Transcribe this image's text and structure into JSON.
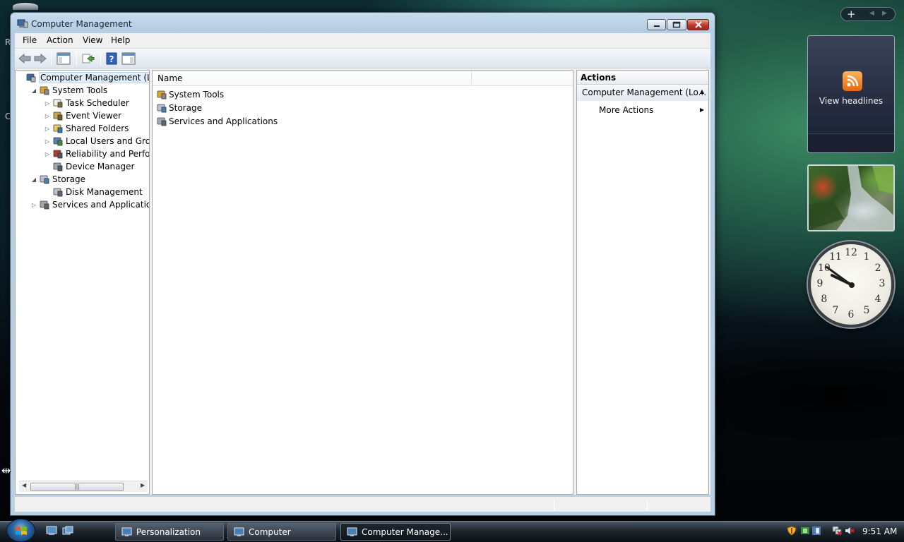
{
  "window": {
    "title": "Computer Management",
    "menu": [
      "File",
      "Action",
      "View",
      "Help"
    ],
    "controls": {
      "minimize": "minimize",
      "maximize": "maximize",
      "close": "close"
    }
  },
  "toolbar": {
    "buttons": [
      "back-icon",
      "forward-icon",
      "show-hide-console-tree-icon",
      "export-list-icon",
      "help-icon",
      "show-hide-action-pane-icon"
    ]
  },
  "tree": {
    "items": [
      {
        "label": "Computer Management (Local",
        "icon": "computer-management-icon",
        "level": 0,
        "expander": "",
        "selected": true
      },
      {
        "label": "System Tools",
        "icon": "tools-icon",
        "level": 1,
        "expander": "◢"
      },
      {
        "label": "Task Scheduler",
        "icon": "clock-icon",
        "level": 2,
        "expander": "▷"
      },
      {
        "label": "Event Viewer",
        "icon": "event-viewer-icon",
        "level": 2,
        "expander": "▷"
      },
      {
        "label": "Shared Folders",
        "icon": "shared-folder-icon",
        "level": 2,
        "expander": "▷"
      },
      {
        "label": "Local Users and Groups",
        "icon": "users-icon",
        "level": 2,
        "expander": "▷"
      },
      {
        "label": "Reliability and Performa",
        "icon": "performance-icon",
        "level": 2,
        "expander": "▷"
      },
      {
        "label": "Device Manager",
        "icon": "device-manager-icon",
        "level": 2,
        "expander": ""
      },
      {
        "label": "Storage",
        "icon": "storage-icon",
        "level": 1,
        "expander": "◢"
      },
      {
        "label": "Disk Management",
        "icon": "disk-icon",
        "level": 2,
        "expander": ""
      },
      {
        "label": "Services and Applications",
        "icon": "services-icon",
        "level": 1,
        "expander": "▷"
      }
    ]
  },
  "list": {
    "column_header": "Name",
    "rows": [
      {
        "label": "System Tools",
        "icon": "tools-icon"
      },
      {
        "label": "Storage",
        "icon": "storage-icon"
      },
      {
        "label": "Services and Applications",
        "icon": "services-icon"
      }
    ]
  },
  "actions": {
    "header": "Actions",
    "group_title": "Computer Management (Lo...",
    "group_collapse": "▲",
    "more_actions": "More Actions",
    "more_arrow": "▶"
  },
  "gadgets": {
    "control_plus": "+",
    "feed_label": "View headlines",
    "clock": {
      "numbers": [
        "12",
        "1",
        "2",
        "3",
        "4",
        "5",
        "6",
        "7",
        "8",
        "9",
        "10",
        "11"
      ],
      "hour": 9,
      "minute": 51
    }
  },
  "taskbar": {
    "tasks": [
      {
        "label": "Personalization",
        "icon": "personalization-icon",
        "active": false
      },
      {
        "label": "Computer",
        "icon": "computer-icon",
        "active": false
      },
      {
        "label": "Computer Manage...",
        "icon": "computer-management-icon",
        "active": true
      }
    ],
    "time": "9:51 AM"
  },
  "desktop": {
    "fragment_1": "R",
    "fragment_2": "C"
  },
  "colors": {
    "selection": "#e3effb",
    "close_button": "#c2372a",
    "feed_orange": "#e6670b"
  }
}
